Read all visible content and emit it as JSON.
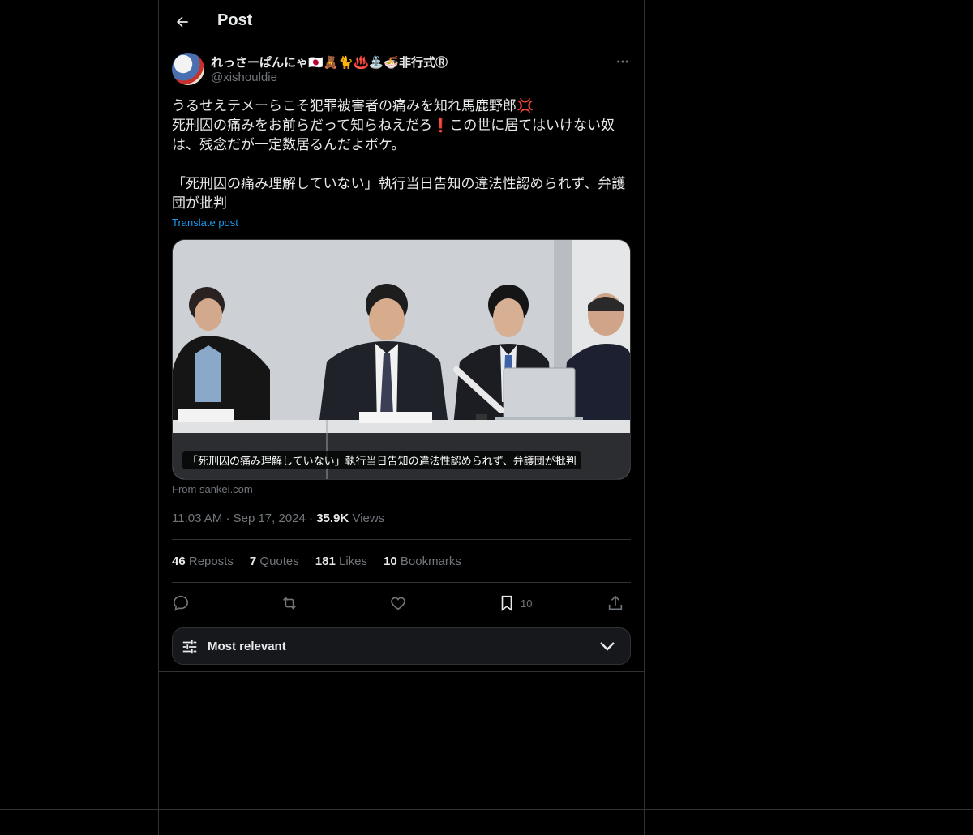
{
  "header": {
    "title": "Post"
  },
  "post": {
    "author": {
      "display_name": "れっさーぱんにゃ🇯🇵🧸🐈♨️⛲🍜非行式Ⓡ",
      "handle": "@xishouldie"
    },
    "text": "うるせえテメーらこそ犯罪被害者の痛みを知れ馬鹿野郎💢\n死刑囚の痛みをお前らだって知らねえだろ❗️この世に居てはいけない奴は、残念だが一定数居るんだよボケ。\n\n「死刑囚の痛み理解していない」執行当日告知の違法性認められず、弁護団が批判",
    "translate_label": "Translate post",
    "media": {
      "caption": "「死刑囚の痛み理解していない」執行当日告知の違法性認められず、弁護団が批判"
    },
    "source": "From sankei.com",
    "time": "11:03 AM",
    "date": "Sep 17, 2024",
    "views_count": "35.9K",
    "views_label": "Views",
    "stats": [
      {
        "count": "46",
        "label": "Reposts"
      },
      {
        "count": "7",
        "label": "Quotes"
      },
      {
        "count": "181",
        "label": "Likes"
      },
      {
        "count": "10",
        "label": "Bookmarks"
      }
    ],
    "actions": {
      "bookmark_count": "10"
    }
  },
  "replies_sort": {
    "label": "Most relevant"
  },
  "colors": {
    "background": "#000000",
    "text": "#e7e9ea",
    "muted": "#71767b",
    "accent": "#1d9bf0",
    "border": "#2f3336"
  }
}
